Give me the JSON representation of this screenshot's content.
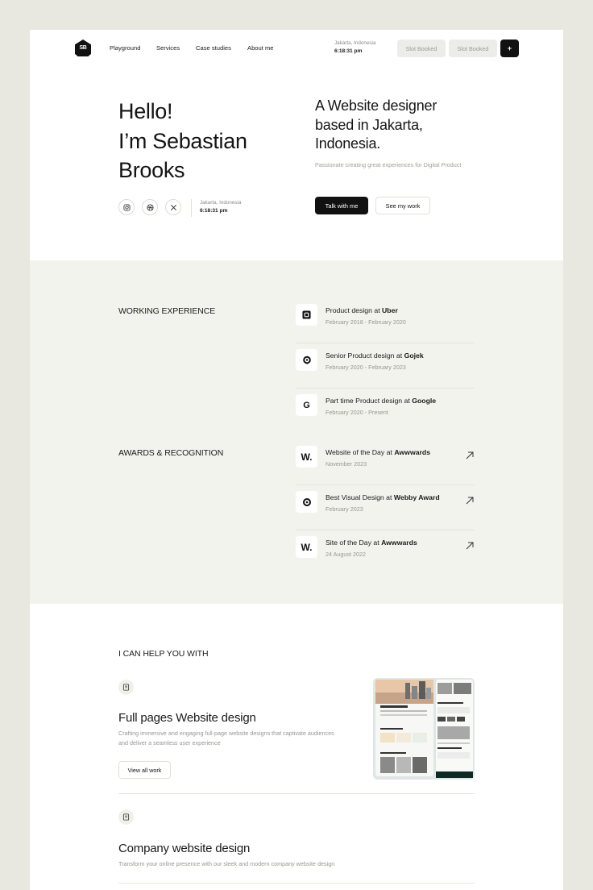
{
  "nav": {
    "logo_text": "SB",
    "links": [
      "Playground",
      "Services",
      "Case studies",
      "About me"
    ],
    "location": "Jakarta, Indonesia",
    "time": "6:18:31 pm",
    "slot_buttons": [
      "Slot Booked",
      "Slot Booked"
    ],
    "plus_label": "+"
  },
  "hero": {
    "name_lines": [
      "Hello!",
      "I’m Sebastian",
      "Brooks"
    ],
    "headline_lines": [
      "A Website designer",
      "based in Jakarta,",
      "Indonesia."
    ],
    "subline": "Passionate creating great experiences for Digital Product",
    "location": "Jakarta, Indonesia",
    "time": "6:18:31 pm",
    "primary_button": "Talk with me",
    "secondary_button": "See my work",
    "social_icons": [
      "instagram-icon",
      "dribbble-icon",
      "x-icon"
    ]
  },
  "experience": {
    "title": "WORKING EXPERIENCE",
    "items": [
      {
        "icon": "uber-icon",
        "prefix": "Product design at ",
        "company": "Uber",
        "date": "February 2018 - February 2020"
      },
      {
        "icon": "gojek-icon",
        "prefix": "Senior Product design at ",
        "company": "Gojek",
        "date": "February 2020 - February 2023"
      },
      {
        "icon": "google-icon",
        "icon_text": "G",
        "prefix": "Part time Product design at ",
        "company": "Google",
        "date": "February 2020 - Present"
      }
    ]
  },
  "awards": {
    "title": "AWARDS & RECOGNITION",
    "items": [
      {
        "icon": "awwwards-icon",
        "icon_text": "W.",
        "prefix": "Website of the Day at ",
        "company": "Awwwards",
        "date": "November 2023"
      },
      {
        "icon": "webby-icon",
        "prefix": "Best Visual Design at ",
        "company": "Webby Award",
        "date": "February 2023"
      },
      {
        "icon": "awwwards-icon",
        "icon_text": "W.",
        "prefix": "Site of the Day at ",
        "company": "Awwwards",
        "date": "24 August 2022"
      }
    ]
  },
  "services": {
    "title": "I CAN HELP YOU WITH",
    "items": [
      {
        "title": "Full pages Website design",
        "description": "Crafting immersive and engaging full-page website designs that captivate audiences and deliver a seamless user experience",
        "button": "View all work"
      },
      {
        "title": "Company website design",
        "description": "Transform your online presence with our sleek and modern company website design"
      }
    ]
  },
  "colors": {
    "page_bg": "#e8e8e1",
    "card_bg": "#ffffff",
    "section_bg": "#f3f3ee",
    "accent_dark": "#111111"
  }
}
